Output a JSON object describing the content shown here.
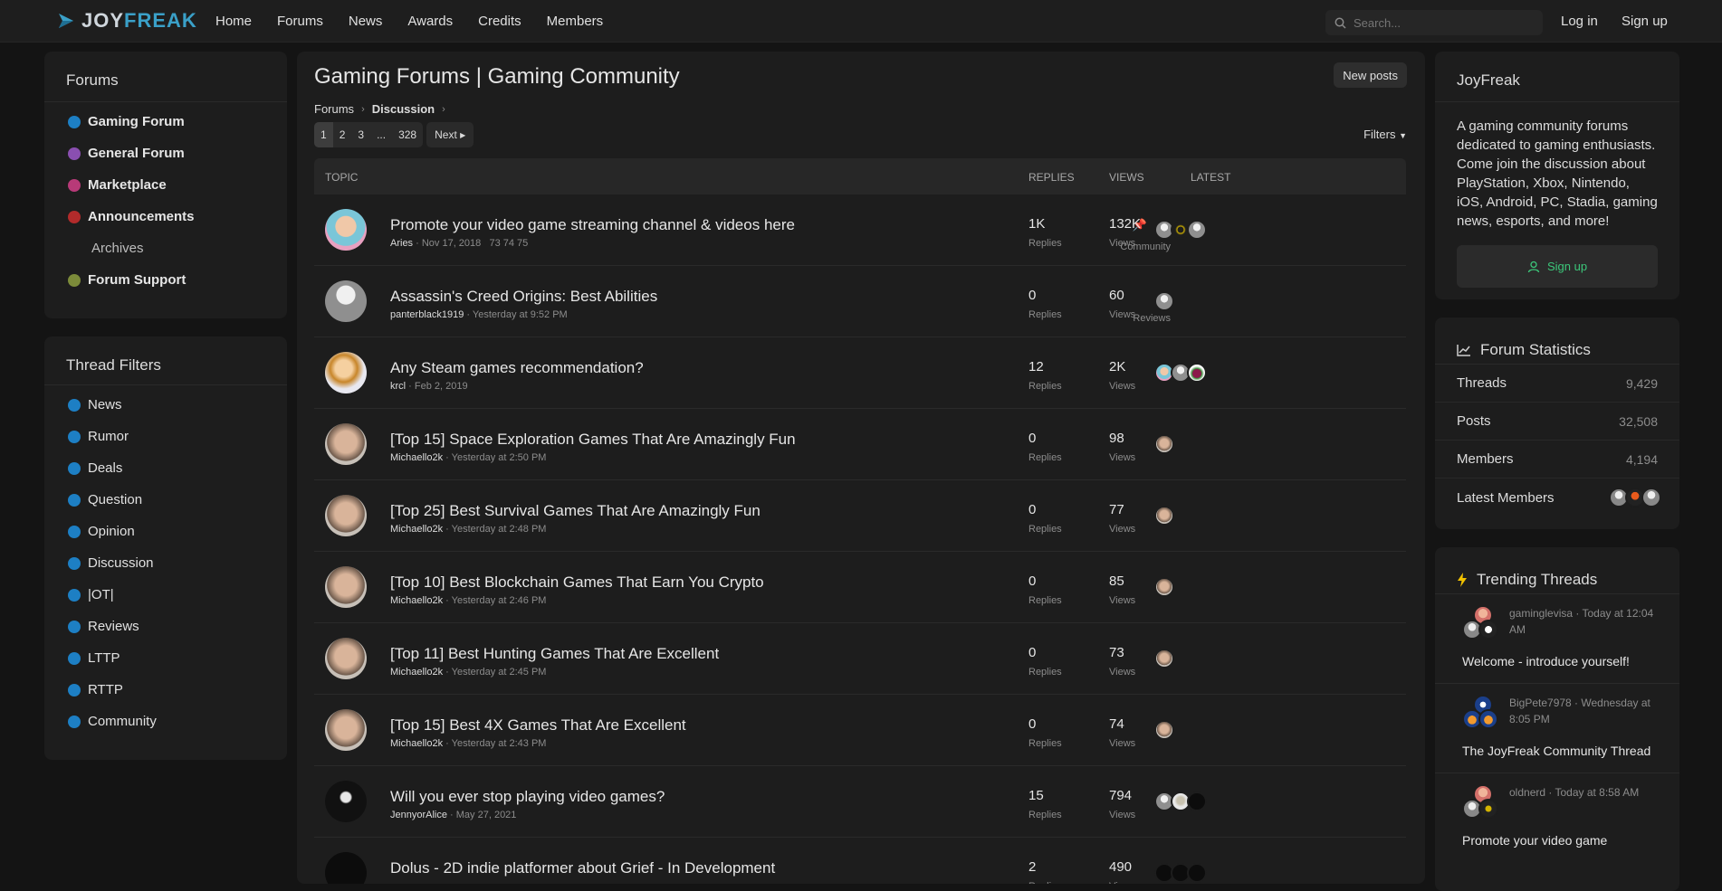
{
  "brand": {
    "logo_part1": "JOY",
    "logo_part2": "FREAK"
  },
  "nav": {
    "items": [
      "Home",
      "Forums",
      "News",
      "Awards",
      "Credits",
      "Members"
    ]
  },
  "search": {
    "placeholder": "Search..."
  },
  "auth": {
    "login": "Log in",
    "signup": "Sign up"
  },
  "forums_panel": {
    "title": "Forums",
    "items": [
      {
        "label": "Gaming Forum",
        "color": "#1d7fc4"
      },
      {
        "label": "General Forum",
        "color": "#8a4fb0"
      },
      {
        "label": "Marketplace",
        "color": "#b83a78"
      },
      {
        "label": "Announcements",
        "color": "#b22b2b"
      },
      {
        "label": "Archives",
        "color": ""
      },
      {
        "label": "Forum Support",
        "color": "#7c8b3a"
      }
    ]
  },
  "filters_panel": {
    "title": "Thread Filters",
    "items": [
      "News",
      "Rumor",
      "Deals",
      "Question",
      "Opinion",
      "Discussion",
      "|OT|",
      "Reviews",
      "LTTP",
      "RTTP",
      "Community"
    ],
    "color": "#1d7fc4"
  },
  "main": {
    "title": "Gaming Forums | Gaming Community",
    "new_posts": "New posts",
    "breadcrumb": [
      "Forums",
      "Discussion"
    ],
    "pager": [
      "1",
      "2",
      "3",
      "...",
      "328"
    ],
    "next": "Next",
    "filters": "Filters",
    "headers": {
      "topic": "TOPIC",
      "replies": "REPLIES",
      "views": "VIEWS",
      "latest": "LATEST"
    },
    "threads": [
      {
        "title": "Promote your video game streaming channel & videos here",
        "user": "Aries",
        "date": "Nov 17, 2018",
        "pages": "73  74  75",
        "prefix": "Community",
        "pinned": true,
        "replies": "1K",
        "views": "132K",
        "avatar": "cartoon",
        "latest": [
          "grey",
          "gold",
          "grey"
        ]
      },
      {
        "title": "Assassin's Creed Origins: Best Abilities",
        "user": "panterblack1919",
        "date": "Yesterday at 9:52 PM",
        "pages": "",
        "prefix": "Reviews",
        "pinned": false,
        "replies": "0",
        "views": "60",
        "avatar": "grey",
        "latest": [
          "grey"
        ]
      },
      {
        "title": "Any Steam games recommendation?",
        "user": "krcl",
        "date": "Feb 2, 2019",
        "pages": "",
        "prefix": "",
        "pinned": false,
        "replies": "12",
        "views": "2K",
        "avatar": "anime",
        "latest": [
          "cartoon",
          "grey",
          "green"
        ]
      },
      {
        "title": "[Top 15] Space Exploration Games That Are Amazingly Fun",
        "user": "Michaello2k",
        "date": "Yesterday at 2:50 PM",
        "pages": "",
        "prefix": "",
        "pinned": false,
        "replies": "0",
        "views": "98",
        "avatar": "face",
        "latest": [
          "face"
        ]
      },
      {
        "title": "[Top 25] Best Survival Games That Are Amazingly Fun",
        "user": "Michaello2k",
        "date": "Yesterday at 2:48 PM",
        "pages": "",
        "prefix": "",
        "pinned": false,
        "replies": "0",
        "views": "77",
        "avatar": "face",
        "latest": [
          "face"
        ]
      },
      {
        "title": "[Top 10] Best Blockchain Games That Earn You Crypto",
        "user": "Michaello2k",
        "date": "Yesterday at 2:46 PM",
        "pages": "",
        "prefix": "",
        "pinned": false,
        "replies": "0",
        "views": "85",
        "avatar": "face",
        "latest": [
          "face"
        ]
      },
      {
        "title": "[Top 11] Best Hunting Games That Are Excellent",
        "user": "Michaello2k",
        "date": "Yesterday at 2:45 PM",
        "pages": "",
        "prefix": "",
        "pinned": false,
        "replies": "0",
        "views": "73",
        "avatar": "face",
        "latest": [
          "face"
        ]
      },
      {
        "title": "[Top 15] Best 4X Games That Are Excellent",
        "user": "Michaello2k",
        "date": "Yesterday at 2:43 PM",
        "pages": "",
        "prefix": "",
        "pinned": false,
        "replies": "0",
        "views": "74",
        "avatar": "face",
        "latest": [
          "face"
        ]
      },
      {
        "title": "Will you ever stop playing video games?",
        "user": "JennyorAlice",
        "date": "May 27, 2021",
        "pages": "",
        "prefix": "",
        "pinned": false,
        "replies": "15",
        "views": "794",
        "avatar": "reaper",
        "latest": [
          "grey",
          "light",
          "dark"
        ]
      },
      {
        "title": "Dolus - 2D indie platformer about Grief - In Development",
        "user": "",
        "date": "",
        "pages": "",
        "prefix": "",
        "pinned": false,
        "replies": "2",
        "views": "490",
        "avatar": "dark",
        "latest": [
          "dark",
          "dark",
          "dark"
        ]
      }
    ],
    "replies_label": "Replies",
    "views_label": "Views"
  },
  "about": {
    "title": "JoyFreak",
    "text": "A gaming community forums dedicated to gaming enthusiasts. Come join the discussion about PlayStation, Xbox, Nintendo, iOS, Android, PC, Stadia, gaming news, esports, and more!",
    "signup": "Sign up"
  },
  "stats": {
    "title": "Forum Statistics",
    "rows": [
      {
        "k": "Threads",
        "v": "9,429"
      },
      {
        "k": "Posts",
        "v": "32,508"
      },
      {
        "k": "Members",
        "v": "4,194"
      }
    ],
    "latest_members": "Latest Members"
  },
  "trending": {
    "title": "Trending Threads",
    "items": [
      {
        "meta": "gaminglevisa · Today at 12:04 AM",
        "title": "Welcome - introduce yourself!"
      },
      {
        "meta": "BigPete7978 · Wednesday at 8:05 PM",
        "title": "The JoyFreak Community Thread"
      },
      {
        "meta": "oldnerd · Today at 8:58 AM",
        "title": "Promote your video game"
      }
    ]
  },
  "colors": {
    "accent": "#3aa0c8",
    "signup": "#3cc77a",
    "trend_icon": "#f2c200"
  }
}
